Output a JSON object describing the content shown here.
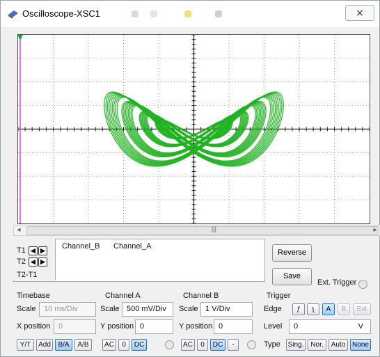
{
  "window": {
    "title": "Oscilloscope-XSC1",
    "close_symbol": "⨯"
  },
  "cursor_panel": {
    "t1_label": "T1",
    "t2_label": "T2",
    "t2t1_label": "T2-T1",
    "col_channel_b": "Channel_B",
    "col_channel_a": "Channel_A"
  },
  "actions": {
    "reverse": "Reverse",
    "save": "Save",
    "ext_trigger": "Ext. Trigger"
  },
  "timebase": {
    "title": "Timebase",
    "scale_label": "Scale",
    "scale_value": "10 ms/Div",
    "xpos_label": "X position",
    "xpos_value": "0",
    "modes": [
      "Y/T",
      "Add",
      "B/A",
      "A/B"
    ],
    "active_mode": "B/A"
  },
  "channel_a": {
    "title": "Channel A",
    "scale_label": "Scale",
    "scale_value": "500 mV/Div",
    "ypos_label": "Y position",
    "ypos_value": "0",
    "coupling": [
      "AC",
      "0",
      "DC"
    ],
    "active": "DC"
  },
  "channel_b": {
    "title": "Channel B",
    "scale_label": "Scale",
    "scale_value": "1  V/Div",
    "ypos_label": "Y position",
    "ypos_value": "0",
    "coupling": [
      "AC",
      "0",
      "DC",
      "-"
    ],
    "active": "DC"
  },
  "trigger": {
    "title": "Trigger",
    "edge_label": "Edge",
    "edge_buttons": [
      "ƒ",
      "ʅ",
      "A",
      "B",
      "Ext"
    ],
    "level_label": "Level",
    "level_value": "0",
    "level_unit": "V",
    "type_label": "Type",
    "types": [
      "Sing.",
      "Nor.",
      "Auto",
      "None"
    ],
    "active_type": "None"
  },
  "colors": {
    "trace": "#22b322",
    "grid": "#9a9a9a",
    "axis": "#1a1a1a",
    "cursor": "#e040e0"
  }
}
